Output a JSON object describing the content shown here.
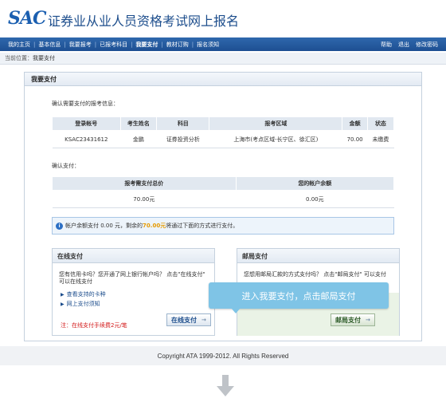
{
  "header": {
    "logo": "SAC",
    "title": "证券业从业人员资格考试网上报名"
  },
  "nav": {
    "items": [
      {
        "label": "我的主页"
      },
      {
        "label": "基本信息"
      },
      {
        "label": "我要报考"
      },
      {
        "label": "已报考科目"
      },
      {
        "label": "我要支付",
        "active": true
      },
      {
        "label": "教材订购"
      },
      {
        "label": "报名须知"
      }
    ],
    "right": [
      "帮助",
      "退出",
      "修改密码"
    ]
  },
  "breadcrumb": {
    "prefix": "当前位置：",
    "current": "我要支付"
  },
  "panel": {
    "title": "我要支付",
    "confirm_label": "确认需要支付的报考信息：",
    "info_headers": [
      "登录帐号",
      "考生姓名",
      "科目",
      "报考区域",
      "金额",
      "状态"
    ],
    "info_row": [
      "KSAC23431612",
      "金鹏",
      "证券投资分析",
      "上海市(考点区域-长宁区、徐汇区)",
      "70.00",
      "未缴费"
    ],
    "pay_label": "确认支付：",
    "sum_headers": [
      "报考需支付总价",
      "您的帐户余额"
    ],
    "sum_values": [
      "70.00元",
      "0.00元"
    ],
    "notice_pre": "帐户余额支付 0.00 元，剩余的",
    "notice_amount": "70.00元",
    "notice_post": "将通过下面的方式进行支付。"
  },
  "online": {
    "title": "在线支付",
    "text": "您有信用卡吗？您开通了网上银行帐户吗？ 点击\"在线支付\" 可以在线支付",
    "links": [
      "查看支持的卡种",
      "网上支付须知"
    ],
    "fee_note": "注：在线支付手续费2元/笔",
    "button": "在线支付"
  },
  "mail": {
    "title": "邮局支付",
    "text": "您想用邮局汇款的方式支付吗？ 点击\"邮局支付\" 可以支付",
    "button": "邮局支付"
  },
  "tooltip": "进入我要支付，点击邮局支付",
  "footer": "Copyright ATA 1999-2012. All Rights Reserved",
  "colors": {
    "nav_bg": "#1d4f92",
    "accent_amount": "#e59a00",
    "fee_note": "#d31b1b",
    "tooltip_bg": "#7fc4e6"
  }
}
